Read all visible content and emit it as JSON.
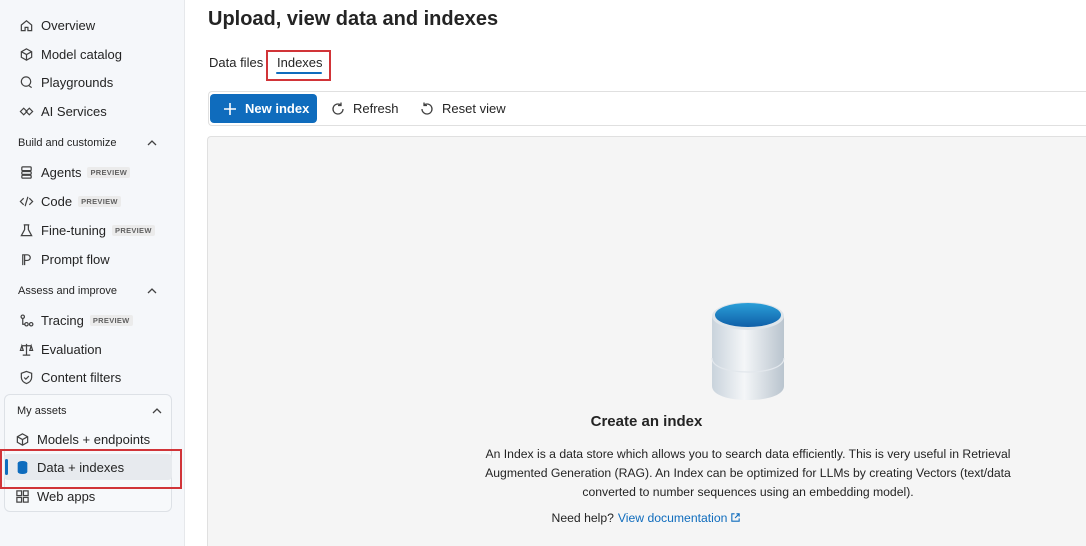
{
  "sidebar": {
    "top_items": [
      {
        "label": "Overview",
        "icon": "home-icon"
      },
      {
        "label": "Model catalog",
        "icon": "cube-icon"
      },
      {
        "label": "Playgrounds",
        "icon": "chat-icon"
      },
      {
        "label": "AI Services",
        "icon": "services-icon"
      }
    ],
    "build_section": {
      "title": "Build and customize",
      "items": [
        {
          "label": "Agents",
          "badge": "PREVIEW",
          "icon": "agents-icon"
        },
        {
          "label": "Code",
          "badge": "PREVIEW",
          "icon": "code-icon"
        },
        {
          "label": "Fine-tuning",
          "badge": "PREVIEW",
          "icon": "flask-icon"
        },
        {
          "label": "Prompt flow",
          "badge": "",
          "icon": "flow-icon"
        }
      ]
    },
    "assess_section": {
      "title": "Assess and improve",
      "items": [
        {
          "label": "Tracing",
          "badge": "PREVIEW",
          "icon": "tracing-icon"
        },
        {
          "label": "Evaluation",
          "icon": "scale-icon"
        },
        {
          "label": "Content filters",
          "icon": "shield-icon"
        }
      ]
    },
    "assets_section": {
      "title": "My assets",
      "items": [
        {
          "label": "Models + endpoints",
          "icon": "cube-icon"
        },
        {
          "label": "Data + indexes",
          "icon": "database-icon"
        },
        {
          "label": "Web apps",
          "icon": "apps-icon"
        }
      ]
    }
  },
  "main": {
    "title": "Upload, view data and indexes",
    "tabs": [
      {
        "label": "Data files"
      },
      {
        "label": "Indexes"
      }
    ],
    "toolbar": {
      "new_label": "New index",
      "refresh_label": "Refresh",
      "reset_label": "Reset view"
    },
    "empty_state": {
      "title": "Create an index",
      "description": "An Index is a data store which allows you to search data efficiently. This is very useful in Retrieval Augmented Generation (RAG). An Index can be optimized for LLMs by creating Vectors (text/data converted to number sequences using an embedding model).",
      "help_prefix": "Need help?",
      "help_link": "View documentation"
    }
  },
  "colors": {
    "accent": "#0f6cbd",
    "highlight": "#d13438"
  }
}
